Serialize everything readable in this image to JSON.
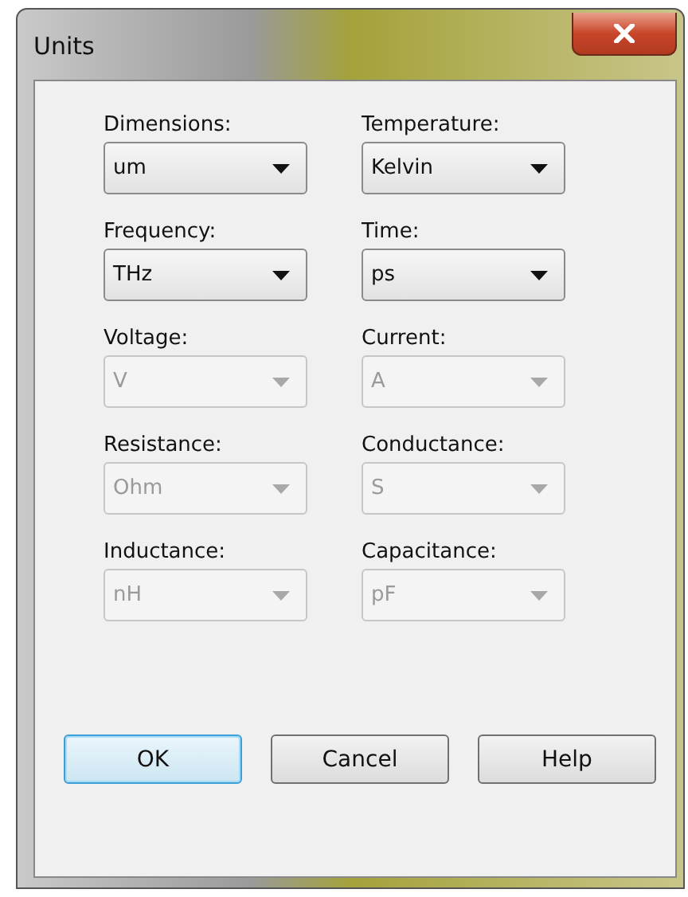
{
  "window": {
    "title": "Units"
  },
  "fields": [
    {
      "label": "Dimensions:",
      "value": "um",
      "disabled": false
    },
    {
      "label": "Temperature:",
      "value": "Kelvin",
      "disabled": false
    },
    {
      "label": "Frequency:",
      "value": "THz",
      "disabled": false
    },
    {
      "label": "Time:",
      "value": "ps",
      "disabled": false
    },
    {
      "label": "Voltage:",
      "value": "V",
      "disabled": true
    },
    {
      "label": "Current:",
      "value": "A",
      "disabled": true
    },
    {
      "label": "Resistance:",
      "value": "Ohm",
      "disabled": true
    },
    {
      "label": "Conductance:",
      "value": "S",
      "disabled": true
    },
    {
      "label": "Inductance:",
      "value": "nH",
      "disabled": true
    },
    {
      "label": "Capacitance:",
      "value": "pF",
      "disabled": true
    }
  ],
  "buttons": [
    {
      "label": "OK",
      "default": true
    },
    {
      "label": "Cancel",
      "default": false
    },
    {
      "label": "Help",
      "default": false
    }
  ]
}
